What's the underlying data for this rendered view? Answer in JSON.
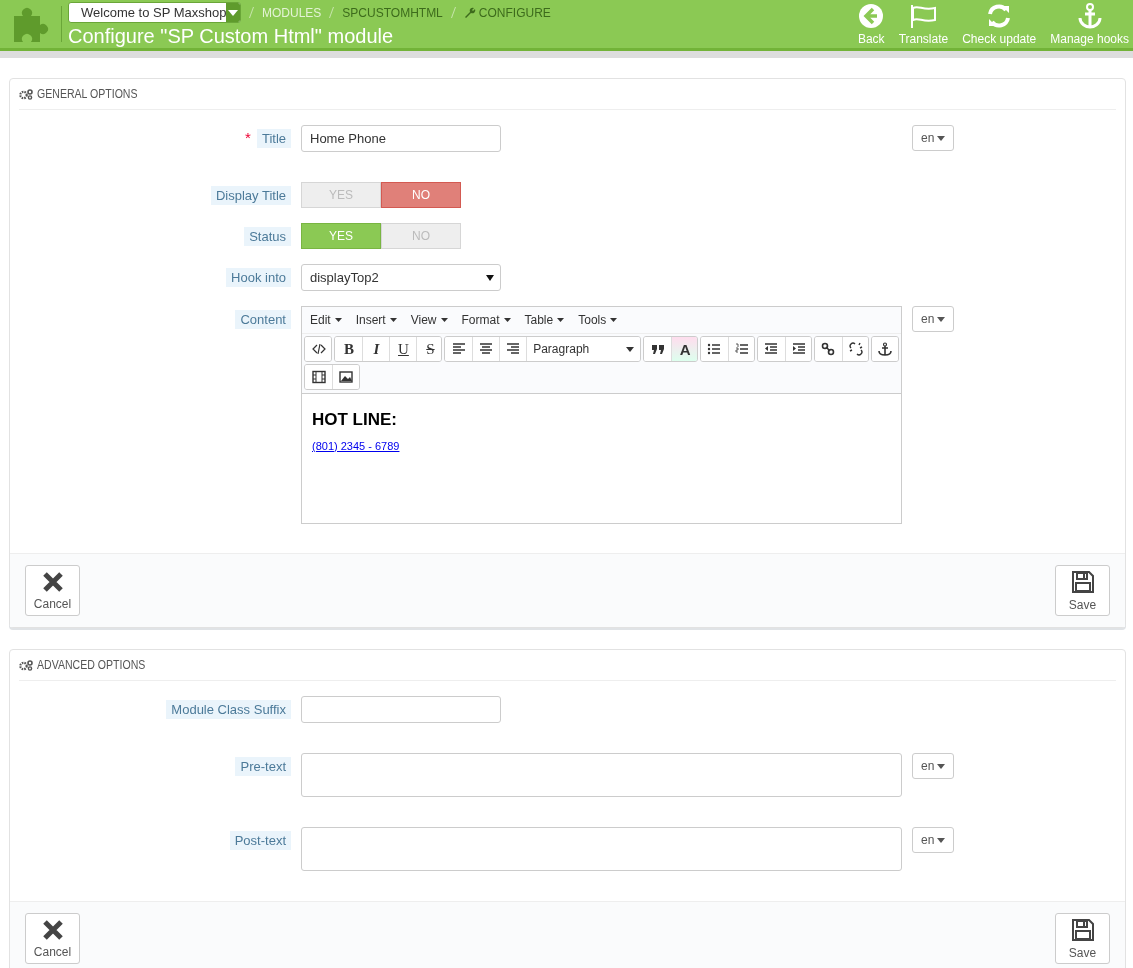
{
  "header": {
    "shop_select": "Welcome to SP Maxshop",
    "breadcrumbs": [
      {
        "label": "MODULES",
        "kind": "plain"
      },
      {
        "label": "SPCUSTOMHTML",
        "kind": "plain"
      },
      {
        "label": "CONFIGURE",
        "kind": "configure"
      }
    ],
    "title": "Configure \"SP Custom Html\" module",
    "toolbar": [
      {
        "kind": "back",
        "label": "Back"
      },
      {
        "kind": "translate",
        "label": "Translate"
      },
      {
        "kind": "update",
        "label": "Check update"
      },
      {
        "kind": "hooks",
        "label": "Manage hooks"
      }
    ]
  },
  "panels": [
    {
      "heading": "GENERAL OPTIONS",
      "fields": [
        {
          "kind": "text",
          "required_mark": "*",
          "label": "Title",
          "value": "Home Phone",
          "lang": "en"
        },
        {
          "kind": "switch",
          "label": "Display Title",
          "options": [
            {
              "label": "YES",
              "selected": false
            },
            {
              "label": "NO",
              "selected": true
            }
          ]
        },
        {
          "kind": "switch",
          "label": "Status",
          "options": [
            {
              "label": "YES",
              "selected": true
            },
            {
              "label": "NO",
              "selected": false
            }
          ]
        },
        {
          "kind": "select",
          "label": "Hook into",
          "value": "displayTop2"
        },
        {
          "kind": "editor",
          "label": "Content",
          "lang": "en",
          "editor": {
            "menus": [
              "Edit",
              "Insert",
              "View",
              "Format",
              "Table",
              "Tools"
            ],
            "rows": [
              [
                [
                  {
                    "kind": "source"
                  }
                ],
                [
                  {
                    "kind": "bold",
                    "label": "B"
                  },
                  {
                    "kind": "italic",
                    "label": "I"
                  },
                  {
                    "kind": "underline",
                    "label": "U"
                  },
                  {
                    "kind": "strike",
                    "label": "S"
                  }
                ],
                [
                  {
                    "kind": "alignleft"
                  },
                  {
                    "kind": "aligncenter"
                  },
                  {
                    "kind": "alignright"
                  },
                  {
                    "kind": "format",
                    "label": "Paragraph"
                  }
                ],
                [
                  {
                    "kind": "quote"
                  },
                  {
                    "kind": "color",
                    "label": "A"
                  }
                ],
                [
                  {
                    "kind": "bullets"
                  },
                  {
                    "kind": "numbers"
                  }
                ],
                [
                  {
                    "kind": "outdent"
                  },
                  {
                    "kind": "indent"
                  }
                ],
                [
                  {
                    "kind": "link"
                  },
                  {
                    "kind": "unlink"
                  }
                ],
                [
                  {
                    "kind": "anchor"
                  }
                ]
              ],
              [
                [
                  {
                    "kind": "video"
                  },
                  {
                    "kind": "image"
                  }
                ]
              ]
            ],
            "heading": "HOT LINE:",
            "link": "(801) 2345 - 6789"
          }
        }
      ],
      "buttons": [
        {
          "kind": "cancel",
          "label": "Cancel"
        },
        {
          "kind": "save",
          "label": "Save"
        }
      ]
    },
    {
      "heading": "ADVANCED OPTIONS",
      "fields": [
        {
          "kind": "text",
          "label": "Module Class Suffix"
        },
        {
          "kind": "textarea",
          "label": "Pre-text",
          "lang": "en"
        },
        {
          "kind": "textarea",
          "label": "Post-text",
          "lang": "en"
        }
      ],
      "buttons": [
        {
          "kind": "cancel",
          "label": "Cancel"
        },
        {
          "kind": "save",
          "label": "Save"
        }
      ]
    }
  ]
}
